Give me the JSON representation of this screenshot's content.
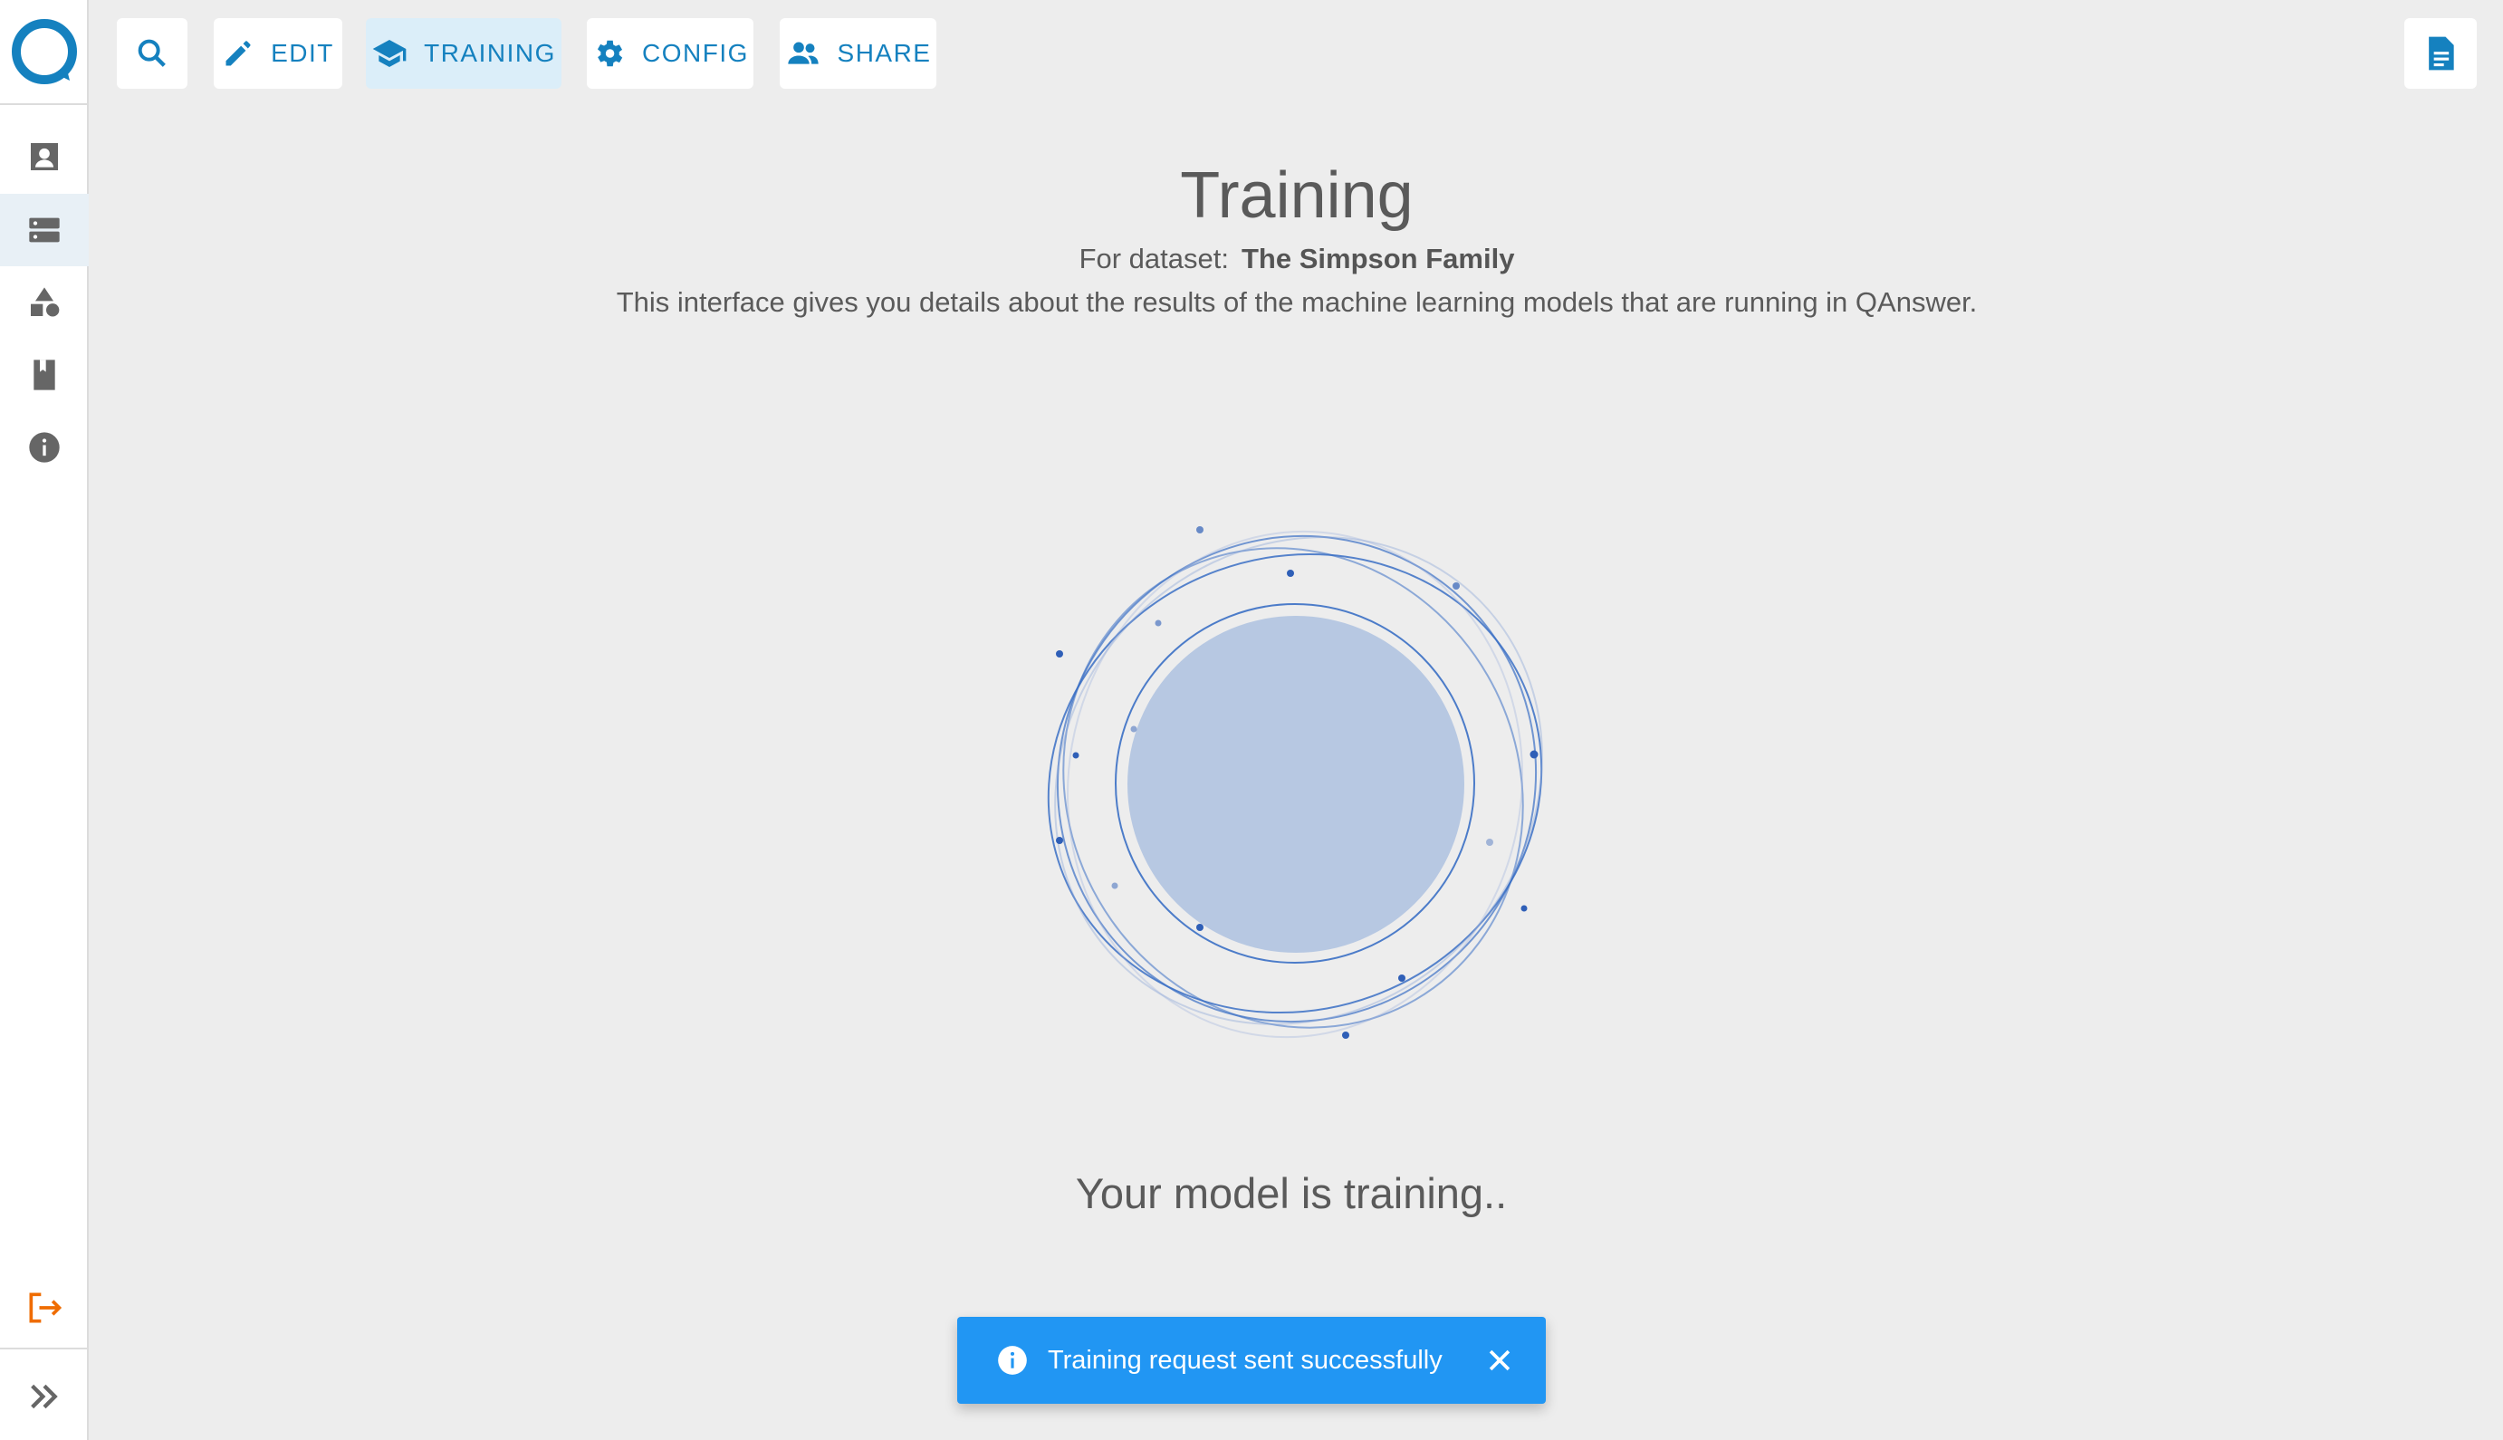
{
  "colors": {
    "accent": "#1581bf",
    "active_tab_bg": "#dbeef9",
    "toast_bg": "#2196f3",
    "logout": "#ef6c00",
    "orb": "#b7c8e2",
    "orb_lines": "#3a6fc4"
  },
  "toolbar": {
    "search_icon": "search-icon",
    "edit_label": "EDIT",
    "training_label": "TRAINING",
    "config_label": "CONFIG",
    "share_label": "SHARE",
    "active_tab": "TRAINING"
  },
  "sidebar": {
    "items": [
      {
        "name": "profile",
        "icon": "contact-card-icon"
      },
      {
        "name": "datasets",
        "icon": "storage-icon",
        "active": true
      },
      {
        "name": "categories",
        "icon": "shapes-icon"
      },
      {
        "name": "docs",
        "icon": "book-icon"
      },
      {
        "name": "info",
        "icon": "info-icon"
      }
    ],
    "logout_icon": "logout-icon",
    "expand_icon": "double-chevron-right-icon"
  },
  "page": {
    "title": "Training",
    "dataset_prefix": "For dataset:",
    "dataset_name": "The Simpson Family",
    "description": "This interface gives you details about the results of the machine learning models that are running in QAnswer.",
    "status": "Your model is training.."
  },
  "toast": {
    "message": "Training request sent successfully",
    "icon": "info-icon",
    "close_icon": "close-icon"
  }
}
